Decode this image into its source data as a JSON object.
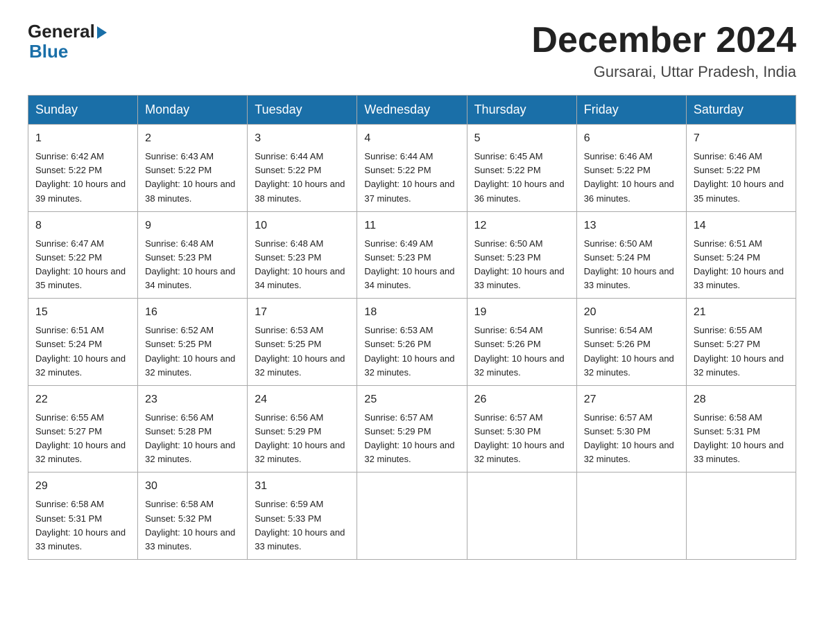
{
  "logo": {
    "general": "General",
    "blue": "Blue"
  },
  "title": {
    "month_year": "December 2024",
    "location": "Gursarai, Uttar Pradesh, India"
  },
  "days_of_week": [
    "Sunday",
    "Monday",
    "Tuesday",
    "Wednesday",
    "Thursday",
    "Friday",
    "Saturday"
  ],
  "weeks": [
    [
      {
        "day": "1",
        "sunrise": "6:42 AM",
        "sunset": "5:22 PM",
        "daylight": "10 hours and 39 minutes."
      },
      {
        "day": "2",
        "sunrise": "6:43 AM",
        "sunset": "5:22 PM",
        "daylight": "10 hours and 38 minutes."
      },
      {
        "day": "3",
        "sunrise": "6:44 AM",
        "sunset": "5:22 PM",
        "daylight": "10 hours and 38 minutes."
      },
      {
        "day": "4",
        "sunrise": "6:44 AM",
        "sunset": "5:22 PM",
        "daylight": "10 hours and 37 minutes."
      },
      {
        "day": "5",
        "sunrise": "6:45 AM",
        "sunset": "5:22 PM",
        "daylight": "10 hours and 36 minutes."
      },
      {
        "day": "6",
        "sunrise": "6:46 AM",
        "sunset": "5:22 PM",
        "daylight": "10 hours and 36 minutes."
      },
      {
        "day": "7",
        "sunrise": "6:46 AM",
        "sunset": "5:22 PM",
        "daylight": "10 hours and 35 minutes."
      }
    ],
    [
      {
        "day": "8",
        "sunrise": "6:47 AM",
        "sunset": "5:22 PM",
        "daylight": "10 hours and 35 minutes."
      },
      {
        "day": "9",
        "sunrise": "6:48 AM",
        "sunset": "5:23 PM",
        "daylight": "10 hours and 34 minutes."
      },
      {
        "day": "10",
        "sunrise": "6:48 AM",
        "sunset": "5:23 PM",
        "daylight": "10 hours and 34 minutes."
      },
      {
        "day": "11",
        "sunrise": "6:49 AM",
        "sunset": "5:23 PM",
        "daylight": "10 hours and 34 minutes."
      },
      {
        "day": "12",
        "sunrise": "6:50 AM",
        "sunset": "5:23 PM",
        "daylight": "10 hours and 33 minutes."
      },
      {
        "day": "13",
        "sunrise": "6:50 AM",
        "sunset": "5:24 PM",
        "daylight": "10 hours and 33 minutes."
      },
      {
        "day": "14",
        "sunrise": "6:51 AM",
        "sunset": "5:24 PM",
        "daylight": "10 hours and 33 minutes."
      }
    ],
    [
      {
        "day": "15",
        "sunrise": "6:51 AM",
        "sunset": "5:24 PM",
        "daylight": "10 hours and 32 minutes."
      },
      {
        "day": "16",
        "sunrise": "6:52 AM",
        "sunset": "5:25 PM",
        "daylight": "10 hours and 32 minutes."
      },
      {
        "day": "17",
        "sunrise": "6:53 AM",
        "sunset": "5:25 PM",
        "daylight": "10 hours and 32 minutes."
      },
      {
        "day": "18",
        "sunrise": "6:53 AM",
        "sunset": "5:26 PM",
        "daylight": "10 hours and 32 minutes."
      },
      {
        "day": "19",
        "sunrise": "6:54 AM",
        "sunset": "5:26 PM",
        "daylight": "10 hours and 32 minutes."
      },
      {
        "day": "20",
        "sunrise": "6:54 AM",
        "sunset": "5:26 PM",
        "daylight": "10 hours and 32 minutes."
      },
      {
        "day": "21",
        "sunrise": "6:55 AM",
        "sunset": "5:27 PM",
        "daylight": "10 hours and 32 minutes."
      }
    ],
    [
      {
        "day": "22",
        "sunrise": "6:55 AM",
        "sunset": "5:27 PM",
        "daylight": "10 hours and 32 minutes."
      },
      {
        "day": "23",
        "sunrise": "6:56 AM",
        "sunset": "5:28 PM",
        "daylight": "10 hours and 32 minutes."
      },
      {
        "day": "24",
        "sunrise": "6:56 AM",
        "sunset": "5:29 PM",
        "daylight": "10 hours and 32 minutes."
      },
      {
        "day": "25",
        "sunrise": "6:57 AM",
        "sunset": "5:29 PM",
        "daylight": "10 hours and 32 minutes."
      },
      {
        "day": "26",
        "sunrise": "6:57 AM",
        "sunset": "5:30 PM",
        "daylight": "10 hours and 32 minutes."
      },
      {
        "day": "27",
        "sunrise": "6:57 AM",
        "sunset": "5:30 PM",
        "daylight": "10 hours and 32 minutes."
      },
      {
        "day": "28",
        "sunrise": "6:58 AM",
        "sunset": "5:31 PM",
        "daylight": "10 hours and 33 minutes."
      }
    ],
    [
      {
        "day": "29",
        "sunrise": "6:58 AM",
        "sunset": "5:31 PM",
        "daylight": "10 hours and 33 minutes."
      },
      {
        "day": "30",
        "sunrise": "6:58 AM",
        "sunset": "5:32 PM",
        "daylight": "10 hours and 33 minutes."
      },
      {
        "day": "31",
        "sunrise": "6:59 AM",
        "sunset": "5:33 PM",
        "daylight": "10 hours and 33 minutes."
      },
      null,
      null,
      null,
      null
    ]
  ]
}
